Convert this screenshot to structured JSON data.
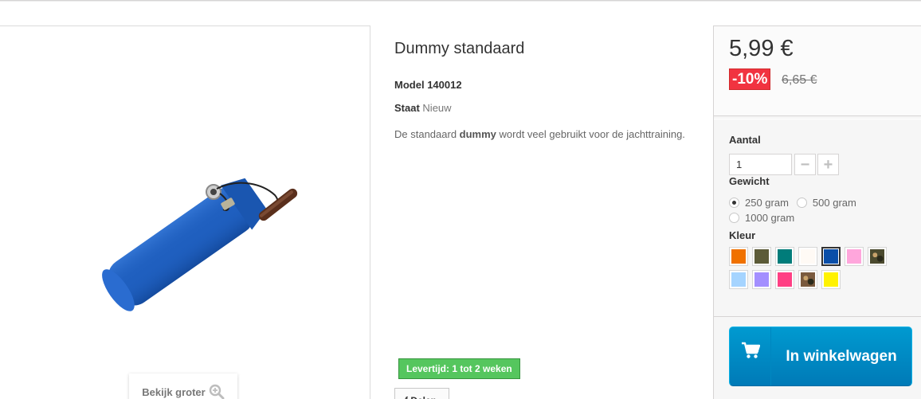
{
  "product": {
    "title": "Dummy standaard",
    "model_label": "Model",
    "model_value": "140012",
    "condition_label": "Staat",
    "condition_value": "Nieuw",
    "desc_before": "De standaard ",
    "desc_bold": "dummy",
    "desc_after": " wordt veel gebruikt voor de jachttraining.",
    "zoom_label": "Bekijk groter",
    "delivery": "Levertijd: 1 tot 2 weken",
    "share_label": "f Delen"
  },
  "pricing": {
    "price": "5,99 €",
    "discount": "-10%",
    "old_price": "6,65 €"
  },
  "options": {
    "quantity_label": "Aantal",
    "quantity_value": "1",
    "minus": "−",
    "plus": "+",
    "weight_label": "Gewicht",
    "weights": [
      {
        "label": "250 gram",
        "selected": true
      },
      {
        "label": "500 gram",
        "selected": false
      },
      {
        "label": "1000 gram",
        "selected": false
      }
    ],
    "color_label": "Kleur",
    "colors": [
      {
        "name": "orange",
        "hex": "#f07100"
      },
      {
        "name": "olive",
        "hex": "#5c5b38"
      },
      {
        "name": "teal",
        "hex": "#007c7a"
      },
      {
        "name": "white",
        "hex": "#fffaf5"
      },
      {
        "name": "blue",
        "hex": "#0a4ea8",
        "selected": true
      },
      {
        "name": "pink",
        "hex": "#ffa6dc"
      },
      {
        "name": "camo-green",
        "hex": "#4b4a2e",
        "pattern": true
      },
      {
        "name": "light-blue",
        "hex": "#a5d4ff"
      },
      {
        "name": "lilac",
        "hex": "#a38fff"
      },
      {
        "name": "magenta",
        "hex": "#ff3f84"
      },
      {
        "name": "camo-brown",
        "hex": "#7a5a3e",
        "pattern": true
      },
      {
        "name": "yellow",
        "hex": "#fff200"
      }
    ]
  },
  "cart": {
    "label": "In winkelwagen"
  },
  "icons": {
    "zoom": "zoom-in-icon",
    "cart": "shopping-cart-icon"
  },
  "colors": {
    "cart_button": "#0095cc",
    "discount_badge": "#f13340",
    "delivery_badge": "#55c65e"
  }
}
